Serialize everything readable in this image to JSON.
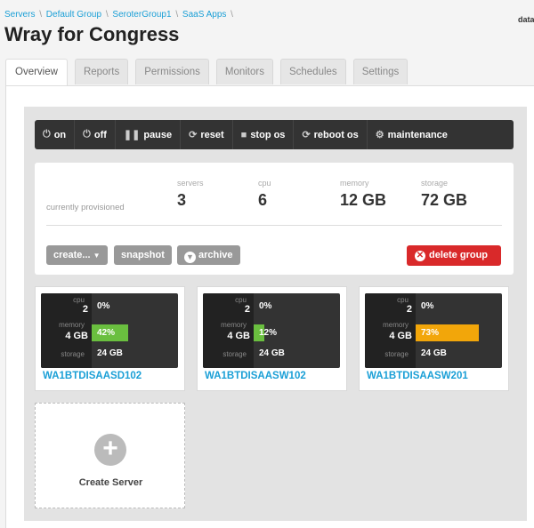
{
  "breadcrumb": [
    "Servers",
    "Default Group",
    "SeroterGroup1",
    "SaaS Apps"
  ],
  "breadcrumb_sep": "\\",
  "header": {
    "title": "Wray for Congress",
    "corner_text": "data c"
  },
  "tabs": [
    "Overview",
    "Reports",
    "Permissions",
    "Monitors",
    "Schedules",
    "Settings"
  ],
  "actions": [
    {
      "icon": "power-icon",
      "glyph": "⏻",
      "label": "on"
    },
    {
      "icon": "power-icon",
      "glyph": "⏻",
      "label": "off"
    },
    {
      "icon": "pause-icon",
      "glyph": "❚❚",
      "label": "pause"
    },
    {
      "icon": "refresh-icon",
      "glyph": "⟳",
      "label": "reset"
    },
    {
      "icon": "stop-icon",
      "glyph": "■",
      "label": "stop os"
    },
    {
      "icon": "refresh-icon",
      "glyph": "⟳",
      "label": "reboot os"
    },
    {
      "icon": "gears-icon",
      "glyph": "⚙",
      "label": "maintenance"
    }
  ],
  "summary": {
    "provisioned_label": "currently provisioned",
    "servers_label": "servers",
    "servers": "3",
    "cpu_label": "cpu",
    "cpu": "6",
    "memory_label": "memory",
    "memory": "12 GB",
    "storage_label": "storage",
    "storage": "72 GB"
  },
  "buttons": {
    "create": "create...",
    "snapshot": "snapshot",
    "archive": "archive",
    "delete": "delete group"
  },
  "servers": [
    {
      "name": "WA1BTDISAASD102",
      "cpu_label": "cpu",
      "cpu": "2",
      "cpu_pct": "0%",
      "memory_label": "memory",
      "memory": "4 GB",
      "mem_pct": "42%",
      "mem_fraction": 0.42,
      "bar_color": "#6abf3f",
      "storage_label": "storage",
      "storage": "24 GB"
    },
    {
      "name": "WA1BTDISAASW102",
      "cpu_label": "cpu",
      "cpu": "2",
      "cpu_pct": "0%",
      "memory_label": "memory",
      "memory": "4 GB",
      "mem_pct": "12%",
      "mem_fraction": 0.12,
      "bar_color": "#6abf3f",
      "storage_label": "storage",
      "storage": "24 GB"
    },
    {
      "name": "WA1BTDISAASW201",
      "cpu_label": "cpu",
      "cpu": "2",
      "cpu_pct": "0%",
      "memory_label": "memory",
      "memory": "4 GB",
      "mem_pct": "73%",
      "mem_fraction": 0.73,
      "bar_color": "#f2a60a",
      "storage_label": "storage",
      "storage": "24 GB"
    }
  ],
  "create_server": {
    "icon": "plus-icon",
    "label": "Create Server"
  }
}
